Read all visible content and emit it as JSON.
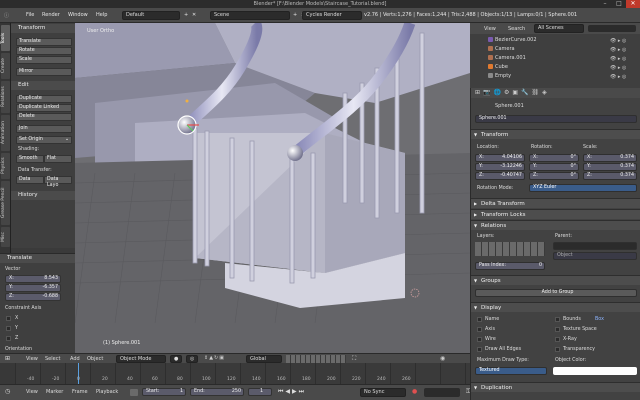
{
  "title_bar": {
    "title": "Blender* [F:\\Blender Models\\Staircase_Tutorial.blend]"
  },
  "info_header": {
    "menus": [
      "File",
      "Render",
      "Window",
      "Help"
    ],
    "layout": "Default",
    "scene": "Scene",
    "engine": "Cycles Render",
    "stats": "v2.76 | Verts:1,276 | Faces:1,244 | Tris:2,488 | Objects:1/13 | Lamps:0/1 | Sphere.001"
  },
  "left_tabs": [
    "Tools",
    "Create",
    "Relations",
    "Animation",
    "Physics",
    "Grease Pencil",
    "Misc"
  ],
  "tools_panel": {
    "transform_title": "Transform",
    "transform_btns": [
      "Translate",
      "Rotate",
      "Scale"
    ],
    "mirror": "Mirror",
    "edit_title": "Edit",
    "edit_btns": [
      "Duplicate",
      "Duplicate Linked",
      "Delete"
    ],
    "join": "Join",
    "set_origin": "Set Origin",
    "shading_label": "Shading:",
    "smooth": "Smooth",
    "flat": "Flat",
    "data_transfer_label": "Data Transfer:",
    "data": "Data",
    "data_layo": "Data Layo",
    "history": "History"
  },
  "operator_panel": {
    "title": "Translate",
    "vector_label": "Vector",
    "x": "X:",
    "xv": "8.543",
    "y": "Y:",
    "yv": "-6.357",
    "z": "Z:",
    "zv": "-0.688",
    "constraint_label": "Constraint Axis",
    "cx": "X",
    "cy": "Y",
    "cz": "Z",
    "orientation": "Orientation"
  },
  "viewport": {
    "label": "User Ortho",
    "object_label": "(1) Sphere.001"
  },
  "viewport_header": {
    "view": "View",
    "select": "Select",
    "add": "Add",
    "object": "Object",
    "mode": "Object Mode",
    "orientation": "Global"
  },
  "timeline": {
    "view": "View",
    "marker": "Marker",
    "frame": "Frame",
    "playback": "Playback",
    "start_label": "Start:",
    "start": "1",
    "end_label": "End:",
    "end": "250",
    "current": "1",
    "sync": "No Sync",
    "ticks": [
      "-40",
      "-20",
      "0",
      "20",
      "40",
      "60",
      "80",
      "100",
      "120",
      "140",
      "160",
      "180",
      "200",
      "220",
      "240",
      "260"
    ]
  },
  "outliner": {
    "view": "View",
    "search": "Search",
    "scope": "All Scenes",
    "items": [
      "BezierCurve.002",
      "Camera",
      "Camera.001",
      "Cube",
      "Empty"
    ]
  },
  "properties": {
    "object_name": "Sphere.001",
    "transform": "Transform",
    "location": "Location:",
    "rotation": "Rotation:",
    "scale": "Scale:",
    "loc": [
      "4.04106",
      "-3.12246",
      "-0.40747"
    ],
    "rot": [
      "0°",
      "0°",
      "0°"
    ],
    "scl": [
      "0.374",
      "0.374",
      "0.374"
    ],
    "axis": [
      "X:",
      "Y:",
      "Z:"
    ],
    "rotation_mode_label": "Rotation Mode:",
    "rotation_mode": "XYZ Euler",
    "delta_transform": "Delta Transform",
    "transform_locks": "Transform Locks",
    "relations": "Relations",
    "layers": "Layers:",
    "parent": "Parent:",
    "parent_type": "Object",
    "pass_index": "Pass Index:",
    "pass_value": "0",
    "groups": "Groups",
    "add_to_group": "Add to Group",
    "display": "Display",
    "name": "Name",
    "axis_chk": "Axis",
    "wire": "Wire",
    "draw_all_edges": "Draw All Edges",
    "bounds": "Bounds",
    "bounds_type": "Box",
    "texture_space": "Texture Space",
    "xray": "X-Ray",
    "transparency": "Transparency",
    "max_draw_type_label": "Maximum Draw Type:",
    "max_draw_type": "Textured",
    "object_color_label": "Object Color:",
    "duplication": "Duplication"
  },
  "colors": {
    "accent": "#5680c2",
    "selected_text": "#8cb4ff"
  }
}
